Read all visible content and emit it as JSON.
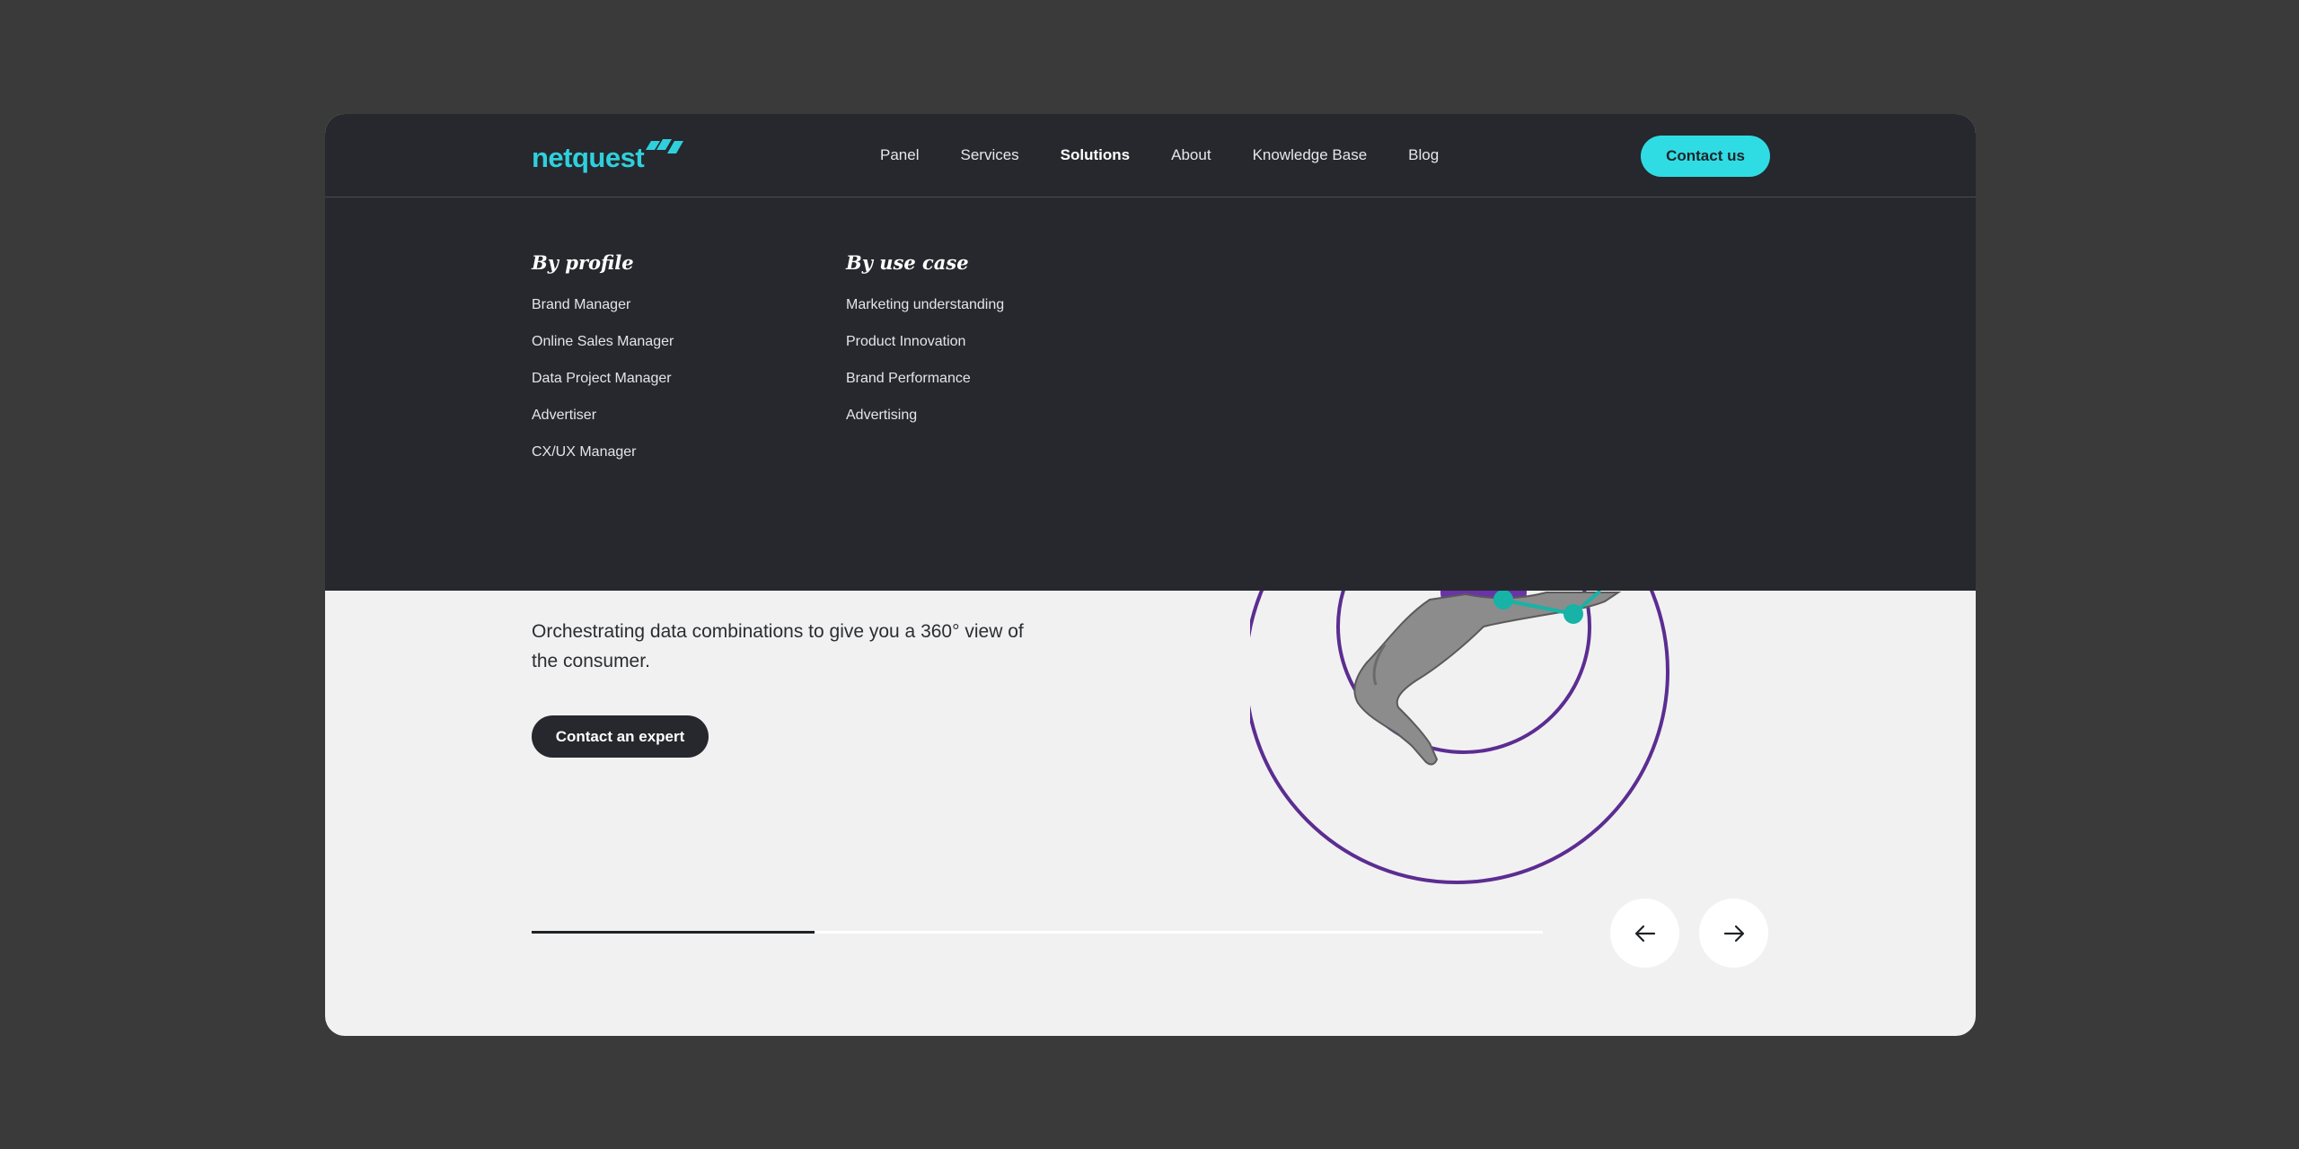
{
  "brand": {
    "name": "netquest",
    "accent_color": "#2fd0dc"
  },
  "nav": {
    "links": [
      {
        "label": "Panel"
      },
      {
        "label": "Services"
      },
      {
        "label": "Solutions",
        "active": true
      },
      {
        "label": "About"
      },
      {
        "label": "Knowledge Base"
      },
      {
        "label": "Blog"
      }
    ],
    "contact_label": "Contact us"
  },
  "mega_menu": {
    "by_profile": {
      "title": "By profile",
      "items": [
        "Brand Manager",
        "Online Sales Manager",
        "Data Project Manager",
        "Advertiser",
        "CX/UX Manager"
      ]
    },
    "by_use_case": {
      "title": "By use case",
      "items": [
        "Marketing understanding",
        "Product Innovation",
        "Brand Performance",
        "Advertising"
      ]
    }
  },
  "hero": {
    "description": "Orchestrating data combinations to give you a 360° view of the consumer.",
    "cta_label": "Contact an expert",
    "slider_progress": 0.28
  },
  "icons": {
    "prev": "arrow-left-icon",
    "next": "arrow-right-icon",
    "logo": "netquest-logo-mark"
  },
  "colors": {
    "dark": "#26282d",
    "light_bg": "#f1f1f1",
    "illustration_purple": "#5b2d91",
    "illustration_teal": "#17b3a6"
  }
}
